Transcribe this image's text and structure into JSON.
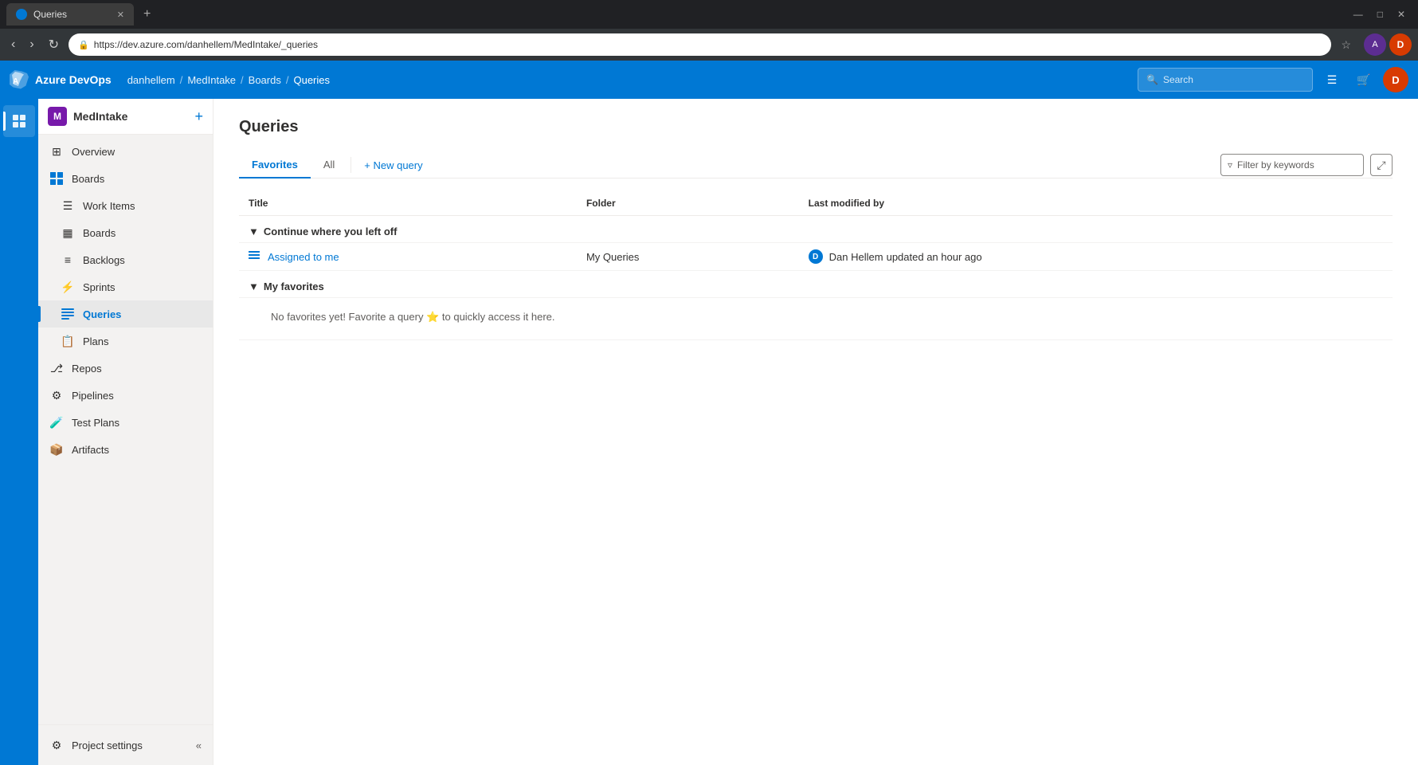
{
  "browser": {
    "tab_title": "Queries",
    "tab_favicon": "Q",
    "url": "https://dev.azure.com/danhellem/MedIntake/_queries",
    "new_tab_icon": "+",
    "controls": [
      "—",
      "□",
      "✕"
    ]
  },
  "topnav": {
    "brand": "Azure DevOps",
    "breadcrumbs": [
      {
        "label": "danhellem"
      },
      {
        "label": "MedIntake"
      },
      {
        "label": "Boards"
      },
      {
        "label": "Queries"
      }
    ],
    "search_placeholder": "Search",
    "icons": [
      "list-icon",
      "basket-icon"
    ],
    "user_initials": "D"
  },
  "sidebar": {
    "project_name": "MedIntake",
    "project_initial": "M",
    "add_label": "+",
    "items": [
      {
        "id": "overview",
        "label": "Overview",
        "icon": "⊞"
      },
      {
        "id": "boards",
        "label": "Boards",
        "icon": "⊡"
      },
      {
        "id": "work-items",
        "label": "Work Items",
        "icon": "☰"
      },
      {
        "id": "boards2",
        "label": "Boards",
        "icon": "▦"
      },
      {
        "id": "backlogs",
        "label": "Backlogs",
        "icon": "≡"
      },
      {
        "id": "sprints",
        "label": "Sprints",
        "icon": "⚡"
      },
      {
        "id": "queries",
        "label": "Queries",
        "icon": "⊟",
        "active": true
      },
      {
        "id": "plans",
        "label": "Plans",
        "icon": "📋"
      },
      {
        "id": "repos",
        "label": "Repos",
        "icon": "⎇"
      },
      {
        "id": "pipelines",
        "label": "Pipelines",
        "icon": "⚙"
      },
      {
        "id": "test-plans",
        "label": "Test Plans",
        "icon": "🧪"
      },
      {
        "id": "artifacts",
        "label": "Artifacts",
        "icon": "📦"
      }
    ],
    "bottom": {
      "label": "Project settings",
      "icon": "⚙",
      "collapse_icon": "«"
    }
  },
  "page": {
    "title": "Queries",
    "tabs": [
      {
        "id": "favorites",
        "label": "Favorites",
        "active": true
      },
      {
        "id": "all",
        "label": "All",
        "active": false
      }
    ],
    "new_query_label": "+ New query",
    "filter_placeholder": "Filter by keywords",
    "columns": [
      {
        "id": "title",
        "label": "Title"
      },
      {
        "id": "folder",
        "label": "Folder"
      },
      {
        "id": "modified",
        "label": "Last modified by"
      }
    ],
    "sections": [
      {
        "id": "continue",
        "label": "Continue where you left off",
        "expanded": true,
        "rows": [
          {
            "title": "Assigned to me",
            "folder": "My Queries",
            "modified_user": "Dan Hellem",
            "modified_user_initial": "D",
            "modified_text": "updated an hour ago"
          }
        ]
      },
      {
        "id": "my-favorites",
        "label": "My favorites",
        "expanded": true,
        "rows": [],
        "empty_text": "No favorites yet! Favorite a query ⭐ to quickly access it here."
      }
    ]
  }
}
